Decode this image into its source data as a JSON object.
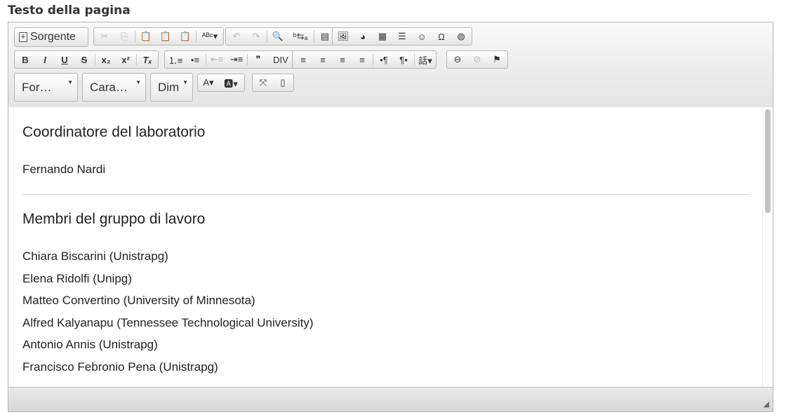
{
  "field": {
    "label": "Testo della pagina"
  },
  "toolbar": {
    "source_label": "Sorgente",
    "row1": {
      "clipboard": [
        {
          "name": "cut-icon",
          "glyph": "✂",
          "disabled": true
        },
        {
          "name": "copy-icon",
          "glyph": "⎘",
          "disabled": true
        },
        {
          "name": "paste-icon",
          "glyph": "📋",
          "disabled": false
        },
        {
          "name": "paste-text-icon",
          "glyph": "📋",
          "disabled": false
        },
        {
          "name": "paste-word-icon",
          "glyph": "📋",
          "disabled": false
        },
        {
          "name": "spellcheck-icon",
          "glyph": "ᴬᴮᶜ▾",
          "disabled": false
        }
      ],
      "edit": [
        {
          "name": "undo-icon",
          "glyph": "↶",
          "disabled": true
        },
        {
          "name": "redo-icon",
          "glyph": "↷",
          "disabled": true
        },
        {
          "name": "find-icon",
          "glyph": "🔍",
          "disabled": false
        },
        {
          "name": "replace-icon",
          "glyph": "ᵇ⇆ₐ",
          "disabled": false
        },
        {
          "name": "select-all-icon",
          "glyph": "▤",
          "disabled": false
        }
      ],
      "insert": [
        {
          "name": "image-icon",
          "glyph": "🖼",
          "disabled": false
        },
        {
          "name": "flash-icon",
          "glyph": "◕",
          "disabled": false
        },
        {
          "name": "table-icon",
          "glyph": "▦",
          "disabled": false
        },
        {
          "name": "horizontal-rule-icon",
          "glyph": "☰",
          "disabled": false
        },
        {
          "name": "smiley-icon",
          "glyph": "☺",
          "disabled": false
        },
        {
          "name": "special-char-icon",
          "glyph": "Ω",
          "disabled": false
        },
        {
          "name": "iframe-icon",
          "glyph": "◍",
          "disabled": false
        }
      ]
    },
    "row2": {
      "basic": [
        {
          "name": "bold-icon",
          "glyph": "B",
          "style": "font-weight:bold"
        },
        {
          "name": "italic-icon",
          "glyph": "I",
          "style": "font-style:italic;font-weight:bold"
        },
        {
          "name": "underline-icon",
          "glyph": "U",
          "style": "text-decoration:underline;font-weight:bold"
        },
        {
          "name": "strike-icon",
          "glyph": "S",
          "style": "text-decoration:line-through;font-weight:bold"
        },
        {
          "name": "subscript-icon",
          "glyph": "x₂",
          "style": "font-weight:bold"
        },
        {
          "name": "superscript-icon",
          "glyph": "x²",
          "style": "font-weight:bold"
        },
        {
          "name": "remove-format-icon",
          "glyph": "Tₓ",
          "style": "font-style:italic;font-weight:bold"
        }
      ],
      "lists": [
        {
          "name": "numbered-list-icon",
          "glyph": "⒈≡",
          "disabled": false
        },
        {
          "name": "bulleted-list-icon",
          "glyph": "•≡",
          "disabled": false
        },
        {
          "name": "outdent-icon",
          "glyph": "⇤≡",
          "disabled": true
        },
        {
          "name": "indent-icon",
          "glyph": "⇥≡",
          "disabled": false
        },
        {
          "name": "blockquote-icon",
          "glyph": "❞",
          "disabled": false
        },
        {
          "name": "div-icon",
          "glyph": "DIV",
          "disabled": false
        }
      ],
      "align": [
        {
          "name": "align-left-icon",
          "glyph": "≡"
        },
        {
          "name": "align-center-icon",
          "glyph": "≡"
        },
        {
          "name": "align-right-icon",
          "glyph": "≡"
        },
        {
          "name": "justify-icon",
          "glyph": "≡"
        },
        {
          "name": "ltr-icon",
          "glyph": "•¶"
        },
        {
          "name": "rtl-icon",
          "glyph": "¶•"
        },
        {
          "name": "language-icon",
          "glyph": "話▾"
        }
      ],
      "links": [
        {
          "name": "link-icon",
          "glyph": "⊖",
          "disabled": false
        },
        {
          "name": "unlink-icon",
          "glyph": "⊘",
          "disabled": true
        },
        {
          "name": "anchor-icon",
          "glyph": "⚑",
          "disabled": false
        }
      ]
    },
    "combos": {
      "format": "For…",
      "font": "Cara…",
      "size": "Dim"
    },
    "row3": {
      "colors": [
        {
          "name": "text-color-icon",
          "glyph": "A▾"
        },
        {
          "name": "bg-color-icon",
          "glyph": "🅰▾"
        }
      ],
      "tools": [
        {
          "name": "maximize-icon",
          "glyph": "⤧"
        },
        {
          "name": "show-blocks-icon",
          "glyph": "▯"
        }
      ]
    }
  },
  "content": {
    "heading1": "Coordinatore del laboratorio",
    "coordinator": "Fernando Nardi",
    "heading2": "Membri del gruppo di lavoro",
    "members": [
      "Chiara Biscarini (Unistrapg)",
      "Elena Ridolfi (Unipg)",
      "Matteo Convertino (University of Minnesota)",
      "Alfred Kalyanapu (Tennessee Technological University)",
      "Antonio Annis (Unistrapg)",
      "Francisco Febronio Pena (Unistrapg)"
    ]
  }
}
